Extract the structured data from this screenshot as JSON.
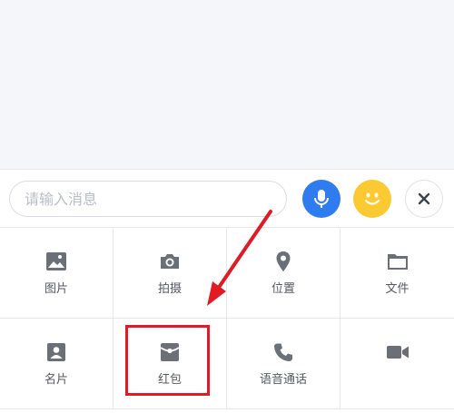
{
  "input": {
    "placeholder": "请输入消息"
  },
  "toolbar": {
    "voice_icon": "microphone-icon",
    "emoji_icon": "smiley-icon",
    "close_icon": "close-icon"
  },
  "panel": {
    "items": [
      {
        "label": "图片",
        "icon": "image-icon"
      },
      {
        "label": "拍摄",
        "icon": "camera-icon"
      },
      {
        "label": "位置",
        "icon": "location-pin-icon"
      },
      {
        "label": "文件",
        "icon": "folder-icon"
      },
      {
        "label": "名片",
        "icon": "contact-card-icon"
      },
      {
        "label": "红包",
        "icon": "red-packet-icon"
      },
      {
        "label": "语音通话",
        "icon": "phone-icon"
      },
      {
        "label": "",
        "icon": "video-camera-icon"
      }
    ]
  },
  "colors": {
    "accent_blue": "#2f7bf0",
    "emoji_yellow": "#fbc931",
    "highlight_red": "#e01b24",
    "icon_gray": "#6b7078"
  }
}
